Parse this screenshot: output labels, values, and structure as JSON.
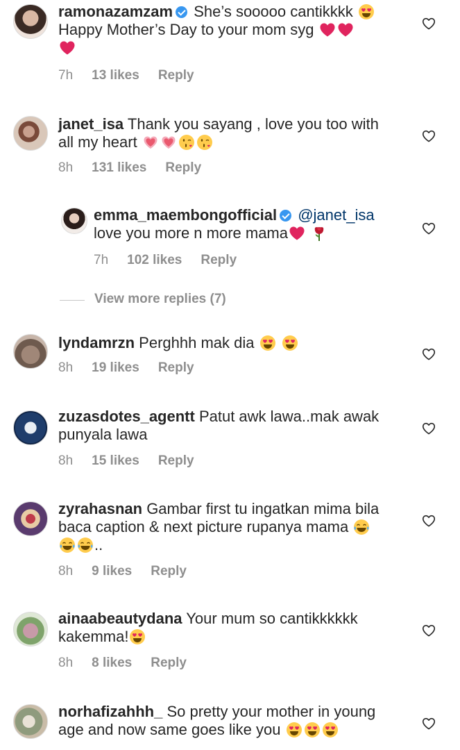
{
  "comments": [
    {
      "user": "ramonazamzam",
      "verified": true,
      "text": "She’s sooooo cantikkkk",
      "line2": "Happy Mother’s Day to your mom syg",
      "time": "7h",
      "likes": "13 likes",
      "reply": "Reply"
    },
    {
      "user": "janet_isa",
      "text": "Thank you sayang , love you too with",
      "line2": "all my heart",
      "time": "8h",
      "likes": "131 likes",
      "reply": "Reply"
    },
    {
      "user": "emma_maembongofficial",
      "verified": true,
      "mention": "@janet_isa",
      "line2": "love you more n more mama",
      "time": "7h",
      "likes": "102 likes",
      "reply": "Reply"
    },
    {
      "user": "lyndamrzn",
      "text": "Perghhh mak dia",
      "time": "8h",
      "likes": "19 likes",
      "reply": "Reply"
    },
    {
      "user": "zuzasdotes_agentt",
      "text": "Patut awk lawa..mak awak",
      "line2": "punyala lawa",
      "time": "8h",
      "likes": "15 likes",
      "reply": "Reply"
    },
    {
      "user": "zyrahasnan",
      "text": "Gambar first tu ingatkan mima bila",
      "line2": "baca caption & next picture rupanya mama",
      "line3": "..",
      "time": "8h",
      "likes": "9 likes",
      "reply": "Reply"
    },
    {
      "user": "ainaabeautydana",
      "text": "Your mum so cantikkkkkk",
      "line2": "kakemma!",
      "time": "8h",
      "likes": "8 likes",
      "reply": "Reply"
    },
    {
      "user": "norhafizahhh_",
      "text": "So pretty your mother in young",
      "line2": "age and now same goes like you"
    }
  ],
  "view_more": "View more replies (7)",
  "icons": {
    "like": "heart-outline-icon",
    "emoji_heart_eyes": "heart-eyes-emoji",
    "emoji_red_heart": "red-heart-emoji",
    "emoji_growing_heart": "growing-heart-emoji",
    "emoji_kiss": "face-blowing-kiss-emoji",
    "emoji_rose": "rose-emoji",
    "emoji_laugh": "tears-of-joy-emoji",
    "verified": "verified-badge-icon"
  },
  "colors": {
    "text": "#262626",
    "meta": "#8e8e8e",
    "mention": "#003569",
    "verified": "#3897f0",
    "heart_emoji": "#ed4956"
  }
}
